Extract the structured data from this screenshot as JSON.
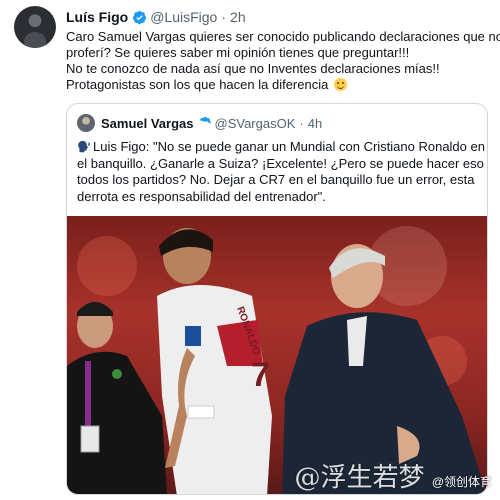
{
  "tweet": {
    "author_name": "Luís Figo",
    "handle": "@LuisFigo",
    "separator": "·",
    "time": "2h",
    "lines": [
      "Caro Samuel Vargas quieres ser conocido publicando declaraciones que no",
      "proferí? Se quieres saber mi opinión tienes que preguntar!!!",
      "No te conozco de nada así que no Inventes declaraciones mías!!",
      "Protagonistas son los que hacen la diferencia"
    ],
    "emoji": "smiling-face"
  },
  "quoted": {
    "author_name": "Samuel Vargas",
    "handle": "@SVargasOK",
    "separator": "·",
    "time": "4h",
    "lines": [
      "Luis Figo: \"No se puede ganar un Mundial con Cristiano Ronaldo en",
      "el banquillo. ¿Ganarle a Suiza? ¡Excelente! ¿Pero se puede hacer eso en",
      "todos los partidos? No. Dejar a CR7 en el banquillo fue un error, esta",
      "derrota es responsabilidad del entrenador\"."
    ],
    "speaking_icon": "speaking-head-icon",
    "jersey_name": "RONALDO",
    "jersey_number": "7"
  },
  "watermark": {
    "big_text": "@浮生若梦",
    "small_text": "@领创体育"
  },
  "colors": {
    "verified_blue": "#1d9bf0",
    "meta_gray": "#536471",
    "border": "#cfd9de"
  }
}
